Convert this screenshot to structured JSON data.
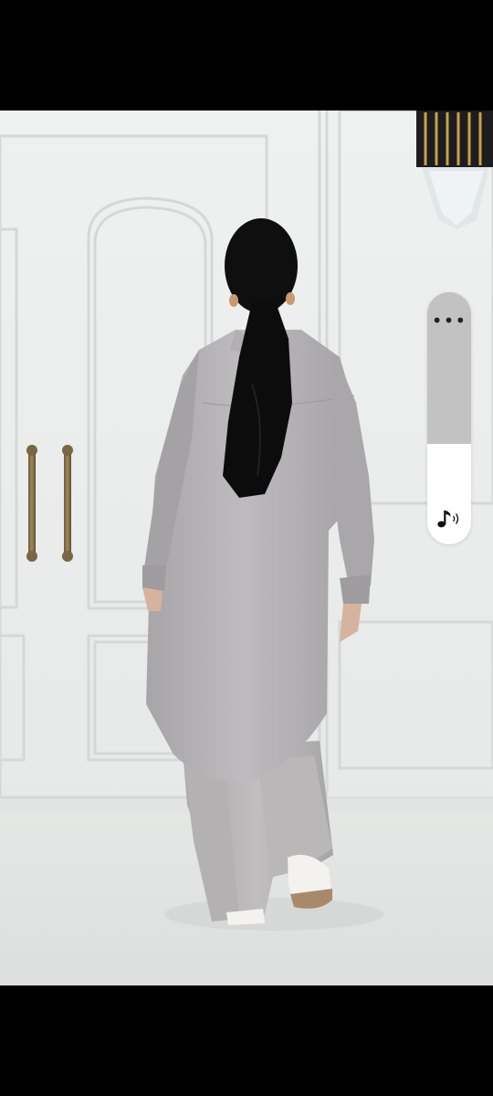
{
  "player": {
    "volume_level_percent": 40,
    "more_options_glyph": "•••",
    "icons": {
      "more": "more-options-icon",
      "sound": "music-note-volume-icon"
    },
    "colors": {
      "slider_track": "#c2c2c2",
      "slider_fill": "#ffffff",
      "icon": "#111111",
      "letterbox": "#000000"
    }
  }
}
